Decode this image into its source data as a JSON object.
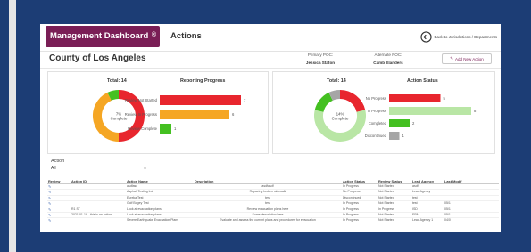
{
  "nav": {
    "tab_active": "Management Dashboard",
    "tab_active_sup": "®",
    "tab_second": "Actions",
    "back_link": "Back to Jurisdictions / Departments"
  },
  "header": {
    "county": "County of Los Angeles",
    "primary_poc_label": "Primary POC:",
    "primary_poc_name": "Jessica Staton",
    "alternate_poc_label": "Alternate POC:",
    "alternate_poc_name": "Camb Elanders",
    "add_button": "Add New Action"
  },
  "reporting_progress": {
    "title": "Reporting Progress",
    "total_label": "Total: 14",
    "donut_center": "7% Complete",
    "colors": {
      "not_started": "#e8262e",
      "in_progress": "#f5a623",
      "complete": "#44c021"
    },
    "chart_data": {
      "type": "bar",
      "categories": [
        "Review Not Started",
        "Review In Progress",
        "Review Complete"
      ],
      "values": [
        7,
        6,
        1
      ],
      "donut": [
        {
          "label": "Review Not Started",
          "value": 7
        },
        {
          "label": "Review In Progress",
          "value": 6
        },
        {
          "label": "Review Complete",
          "value": 1
        }
      ],
      "xlim": [
        0,
        7
      ]
    }
  },
  "action_status": {
    "title": "Action Status",
    "total_label": "Total: 14",
    "donut_center": "14% Complete",
    "colors": {
      "no_progress": "#e8262e",
      "in_progress": "#b9e6a5",
      "completed": "#44c021",
      "discontinued": "#a6a6a6"
    },
    "chart_data": {
      "type": "bar",
      "categories": [
        "No Progress",
        "In Progress",
        "Completed",
        "Discontinued"
      ],
      "values": [
        5,
        8,
        2,
        1
      ],
      "donut": [
        {
          "label": "No Progress",
          "value": 3
        },
        {
          "label": "In Progress",
          "value": 8
        },
        {
          "label": "Completed",
          "value": 2
        },
        {
          "label": "Discontinued",
          "value": 1
        }
      ],
      "xlim": [
        0,
        8
      ]
    }
  },
  "filters": {
    "action_label": "Action",
    "action_value": "All"
  },
  "table": {
    "columns": [
      "Review",
      "Action ID",
      "Action Name",
      "Description",
      "Action Status",
      "Review Status",
      "Lead Agency",
      "Last Modif"
    ],
    "rows": [
      [
        "✎",
        "",
        "asdfasd",
        "asdfasdf",
        "In Progress",
        "Not Started",
        "asdf",
        ""
      ],
      [
        "✎",
        "",
        "Asphalt Testing Lot",
        "Repaving broken sidewalk",
        "No Progress",
        "Not Started",
        "Lead Agency",
        ""
      ],
      [
        "✎",
        "",
        "Eureka Test",
        "test",
        "Discontinued",
        "Not Started",
        "test",
        ""
      ],
      [
        "✎",
        "",
        "Golf Bogey Test",
        "test",
        "In Progress",
        "Not Started",
        "test",
        "05/1"
      ],
      [
        "✎",
        "R1 ST",
        "Look at evacuation plans",
        "Review evacuation plans here",
        "In Progress",
        "In Progress",
        "ISD",
        "05/1"
      ],
      [
        "✎",
        "2021-01-19 - this is an action",
        "Look at evacuation plans",
        "Some description here",
        "In Progress",
        "Not Started",
        "EPA",
        "05/1"
      ],
      [
        "✎",
        "",
        "Severe Earthquake Evacuation Plans",
        "Evaluate and assess the current plans and procedures for evacuation",
        "In Progress",
        "Not Started",
        "Lead Agency 1",
        "04/0"
      ]
    ]
  }
}
